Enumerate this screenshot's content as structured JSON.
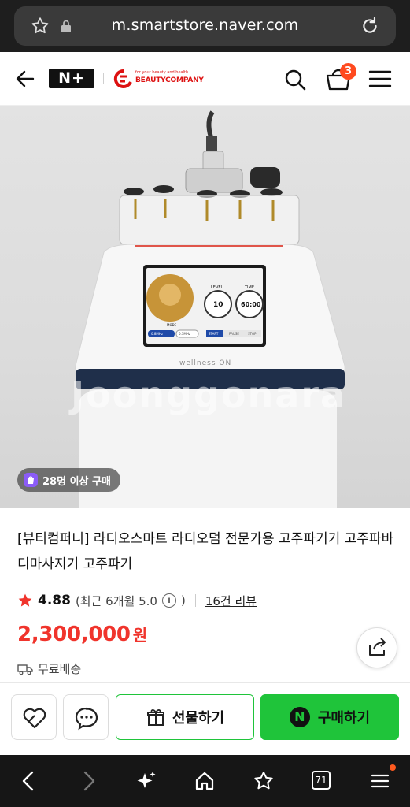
{
  "browser": {
    "url": "m.smartstore.naver.com",
    "tab_count": "71"
  },
  "header": {
    "nplus_logo": "N+",
    "brand_tagline": "for your beauty and health",
    "brand_name": "BEAUTYCOMPANY",
    "cart_count": "3"
  },
  "product_image": {
    "watermark": "Joonggonara",
    "device_brand": "wellness ON",
    "screen": {
      "level_label": "LEVEL",
      "level_value": "10",
      "time_label": "TIME",
      "time_value": "60:00",
      "mode_label": "MODE",
      "mode_1": "0.8MHz",
      "mode_2": "0.3MHz",
      "btn_start": "START",
      "btn_pause": "PAUSE",
      "btn_stop": "STOP"
    },
    "buyers_badge": "28명 이상 구매"
  },
  "product": {
    "title": "[뷰티컴퍼니] 라디오스마트 라디오덤 전문가용 고주파기기 고주파바디마사지기 고주파기",
    "rating": "4.88",
    "rating_detail": "(최근 6개월 5.0",
    "rating_paren_close": ")",
    "review_link": "16건 리뷰",
    "price": "2,300,000",
    "price_unit": "원",
    "shipping": "무료배송"
  },
  "actions": {
    "gift_label": "선물하기",
    "buy_label": "구매하기",
    "npay_letter": "N"
  },
  "colors": {
    "price": "#f0342c",
    "naver_green": "#1fc43a",
    "badge": "#ff4a1f"
  }
}
